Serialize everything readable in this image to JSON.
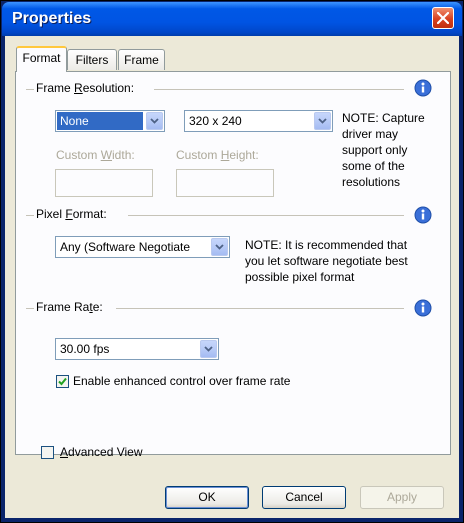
{
  "window": {
    "title": "Properties"
  },
  "tabs": [
    {
      "label": "Format",
      "active": true
    },
    {
      "label": "Filters",
      "active": false
    },
    {
      "label": "Frame",
      "active": false
    }
  ],
  "frame_resolution": {
    "label_pre": "Frame ",
    "label_mnemonic": "R",
    "label_post": "esolution:",
    "size_preset": "None",
    "resolution": "320 x 240",
    "custom_width_pre": "Custom ",
    "custom_width_mnemonic": "W",
    "custom_width_post": "idth:",
    "custom_height_pre": "Custom ",
    "custom_height_mnemonic": "H",
    "custom_height_post": "eight:",
    "custom_width_value": "",
    "custom_height_value": "",
    "note_lines": [
      "NOTE: Capture",
      "driver may",
      "support only",
      "some of the",
      "resolutions"
    ]
  },
  "pixel_format": {
    "label_pre": "Pixel ",
    "label_mnemonic": "F",
    "label_post": "ormat:",
    "value": "Any (Software Negotiate",
    "note_lines": [
      "NOTE: It is recommended that",
      "you let software negotiate best",
      "possible pixel format"
    ]
  },
  "frame_rate": {
    "label_pre": "Frame Ra",
    "label_mnemonic": "t",
    "label_post": "e:",
    "value": "30.00 fps",
    "enhanced_label": "Enable enhanced control over frame rate",
    "enhanced_checked": true
  },
  "advanced_view": {
    "label_mnemonic": "A",
    "label_post": "dvanced View",
    "checked": false
  },
  "buttons": {
    "ok": "OK",
    "cancel": "Cancel",
    "apply": "Apply"
  },
  "colors": {
    "titlebar": "#0054e3",
    "selection": "#316ac5",
    "dialog_bg": "#ece9d8",
    "tab_accent": "#ffc83c"
  },
  "icons": {
    "info": "info-icon",
    "close": "close-icon",
    "dropdown": "chevron-down-icon",
    "check": "check-icon"
  }
}
